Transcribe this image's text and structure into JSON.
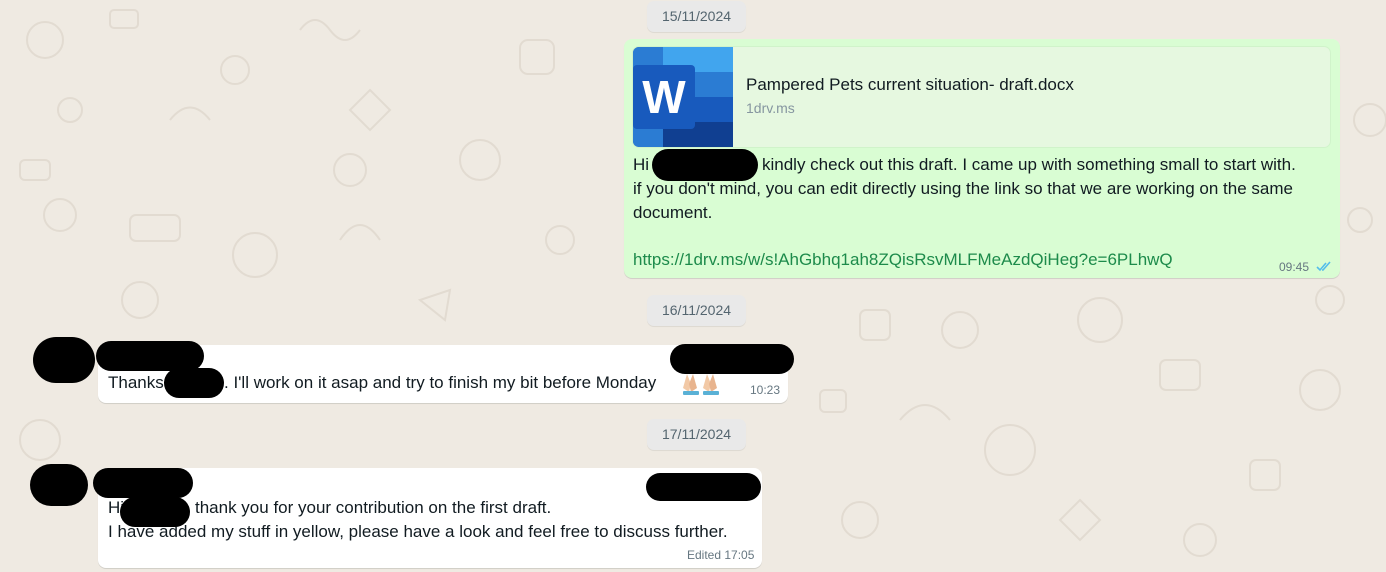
{
  "dates": [
    "15/11/2024",
    "16/11/2024",
    "17/11/2024"
  ],
  "message1": {
    "card_title": "Pampered Pets current situation- draft.docx",
    "card_domain": "1drv.ms",
    "hi": "Hi",
    "line1_rest": "kindly check out this draft. I came up with something small to start with.",
    "line2": "if you don't mind, you can edit directly using the link so that we are working on the same",
    "line3": "document.",
    "link": "https://1drv.ms/w/s!AhGbhq1ah8ZQisRsvMLFMeAzdQiHeg?e=6PLhwQ",
    "time": "09:45"
  },
  "message2": {
    "text_a": "Thanks",
    "text_b": ". I'll work on it asap and try to finish my bit before Monday",
    "time": "10:23"
  },
  "message3": {
    "hi": "Hi",
    "line1_rest": "thank you for your contribution on the first draft.",
    "line2": "I have added my stuff in yellow, please have a look and feel free to discuss further.",
    "time": "Edited 17:05"
  },
  "colors": {
    "background": "#efeae2",
    "outgoing_bubble": "#d9fdd3",
    "incoming_bubble": "#ffffff",
    "link": "#1d8b4b",
    "read_ticks": "#53bdeb"
  }
}
